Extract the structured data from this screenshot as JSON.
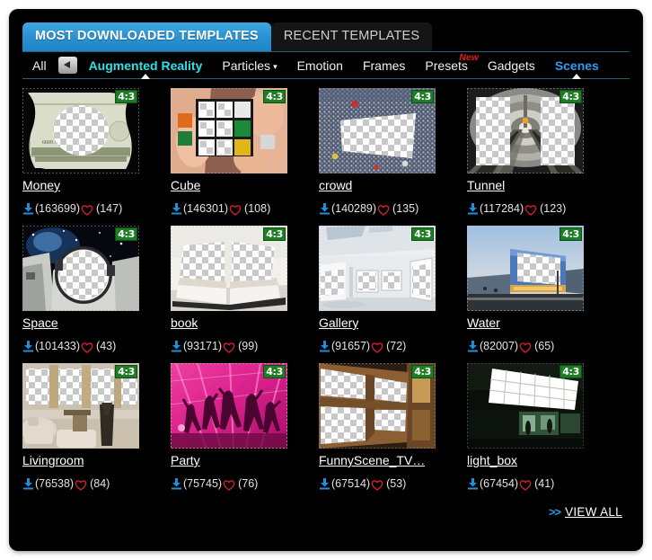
{
  "window": {
    "background_color": "#000000",
    "accent_blue": "#2a92d2",
    "accent_cyan": "#2fe0e8",
    "badge_green": "#1d7c24",
    "new_badge_red": "#e41b1b"
  },
  "tabs": [
    {
      "label": "MOST DOWNLOADED TEMPLATES",
      "active": true
    },
    {
      "label": "RECENT TEMPLATES",
      "active": false
    }
  ],
  "categories": {
    "all_label": "All",
    "prev_arrow_icon": "chevron-left-icon",
    "items": [
      {
        "label": "Augmented Reality",
        "state": "selected-cyan",
        "has_marker": true,
        "has_caret": false,
        "badge": ""
      },
      {
        "label": "Particles",
        "state": "plain",
        "has_marker": false,
        "has_caret": true,
        "badge": ""
      },
      {
        "label": "Emotion",
        "state": "plain",
        "has_marker": false,
        "has_caret": false,
        "badge": ""
      },
      {
        "label": "Frames",
        "state": "plain",
        "has_marker": false,
        "has_caret": false,
        "badge": ""
      },
      {
        "label": "Presets",
        "state": "plain",
        "has_marker": false,
        "has_caret": false,
        "badge": "New"
      },
      {
        "label": "Gadgets",
        "state": "plain",
        "has_marker": false,
        "has_caret": false,
        "badge": ""
      },
      {
        "label": "Scenes",
        "state": "selected-blue",
        "has_marker": true,
        "has_caret": false,
        "badge": ""
      }
    ]
  },
  "templates": [
    [
      {
        "title": "Money",
        "downloads": "(163699)",
        "likes": "(147)",
        "ratio": "4:3",
        "thumb": "money"
      },
      {
        "title": "Cube",
        "downloads": "(146301)",
        "likes": "(108)",
        "ratio": "4:3",
        "thumb": "cube"
      },
      {
        "title": "crowd",
        "downloads": "(140289)",
        "likes": "(135)",
        "ratio": "4:3",
        "thumb": "crowd"
      },
      {
        "title": "Tunnel",
        "downloads": "(117284)",
        "likes": "(123)",
        "ratio": "4:3",
        "thumb": "tunnel"
      }
    ],
    [
      {
        "title": "Space",
        "downloads": "(101433)",
        "likes": "(43)",
        "ratio": "4:3",
        "thumb": "space"
      },
      {
        "title": "book",
        "downloads": "(93171)",
        "likes": "(99)",
        "ratio": "4:3",
        "thumb": "book"
      },
      {
        "title": "Gallery",
        "downloads": "(91657)",
        "likes": "(72)",
        "ratio": "4:3",
        "thumb": "gallery"
      },
      {
        "title": "Water",
        "downloads": "(82007)",
        "likes": "(65)",
        "ratio": "4:3",
        "thumb": "water"
      }
    ],
    [
      {
        "title": "Livingroom",
        "downloads": "(76538)",
        "likes": "(84)",
        "ratio": "4:3",
        "thumb": "livingroom"
      },
      {
        "title": "Party",
        "downloads": "(75745)",
        "likes": "(76)",
        "ratio": "4:3",
        "thumb": "party"
      },
      {
        "title": "FunnyScene_TV…",
        "downloads": "(67514)",
        "likes": "(53)",
        "ratio": "4:3",
        "thumb": "funnyscene"
      },
      {
        "title": "light_box",
        "downloads": "(67454)",
        "likes": "(41)",
        "ratio": "4:3",
        "thumb": "lightbox"
      }
    ]
  ],
  "footer": {
    "chevrons": ">>",
    "view_all_label": "VIEW ALL"
  }
}
